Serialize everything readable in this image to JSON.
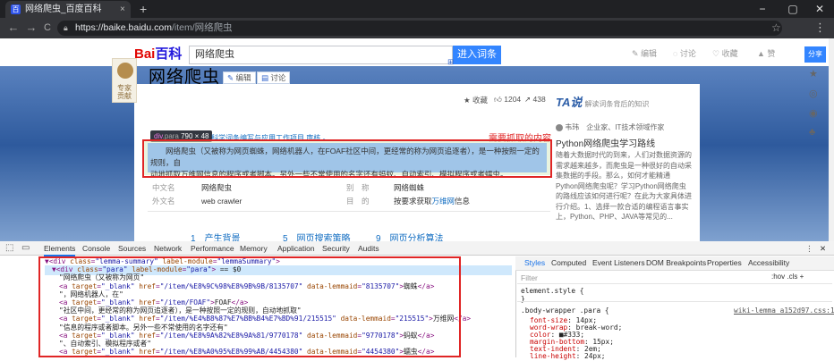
{
  "browser": {
    "tab_title": "网络爬虫_百度百科",
    "tab_close": "×",
    "new_tab": "+",
    "fav_glyph": "百",
    "win_min": "−",
    "win_max": "▢",
    "win_close": "✕",
    "back": "←",
    "forward": "→",
    "reload": "C",
    "url_main": "https://baike.baidu.com",
    "url_path": "/item/网络爬虫",
    "star": "☆",
    "menu": "⋮"
  },
  "page": {
    "logo_a": "Bai",
    "logo_b": "百科",
    "search_value": "网络爬虫",
    "enter_btn": "进入词条",
    "top_links": [
      "✎ 编辑",
      "◌ 讨论",
      "♡ 收藏",
      "▲ 赞"
    ],
    "badge_text": "专家\n贡献",
    "title": "网络爬虫",
    "edit_pill": "编辑",
    "discuss_pill": "讨论",
    "collect": "收藏",
    "like_count": "1204",
    "share_count": "438",
    "tooltip_tag": "div",
    "tooltip_class": ".para",
    "tooltip_dims": "790 × 48",
    "subline": "科学词条编写与应用工作项目 审核 。",
    "red_note": "需要抓取的内容",
    "para_text_1": "网络爬虫（又被称为网页蜘蛛，网络机器人，在FOAF社区中间，更经常的称为网页追逐者），是一种按照一定的规则，自",
    "para_text_2": "动地抓取万维网信息的程序或者脚本。另外一些不常使用的名字还有蚂蚁、自动索引、模拟程序或者蠕虫。",
    "info": {
      "zh_name_k": "中文名",
      "zh_name_v": "网络爬虫",
      "alias_k": "别　称",
      "alias_v": "网络蜘蛛",
      "en_name_k": "外文名",
      "en_name_v": "web crawler",
      "purpose_k": "目　的",
      "purpose_v": "按要求获取",
      "purpose_link": "万维网",
      "purpose_tail": "信息"
    },
    "toc": [
      "1　产生背景",
      "5　网页搜索策略",
      "9　网页分析算法"
    ],
    "right_panel": {
      "ta_logo": "TA说",
      "subtitle": "解读词条背后的知识",
      "author": "韦玮　企业家、IT技术领域作家",
      "article_title": "Python网络爬虫学习路线",
      "article_body": "随着大数据时代的到来，人们对数据资源的需求越来越多，而爬虫是一种很好的自动采集数据的手段。那么，如何才能精通Python网络爬虫呢？学习Python网络爬虫的路线应该如何进行呢？在此为大家具体进行介绍。1、选择一款合适的编程语言事实上，Python、PHP、JAVA等常见的..."
    },
    "share": "分享",
    "share_icons": [
      "★",
      "◎",
      "◉",
      "♣"
    ]
  },
  "devtools": {
    "tabs": [
      "Elements",
      "Console",
      "Sources",
      "Network",
      "Performance",
      "Memory",
      "Application",
      "Security",
      "Audits"
    ],
    "more": "⋮",
    "close": "✕",
    "dom_lines": [
      {
        "indent": 0,
        "parts": [
          [
            "tag",
            "▼<div "
          ],
          [
            "an",
            "class"
          ],
          [
            "tag",
            "="
          ],
          [
            "av",
            "\"lemma-summary\""
          ],
          [
            "an",
            " label-module"
          ],
          [
            "tag",
            "="
          ],
          [
            "av",
            "\"lemmaSummary\""
          ],
          [
            "tag",
            ">"
          ]
        ]
      },
      {
        "indent": 1,
        "parts": [
          [
            "tag",
            "▼<div "
          ],
          [
            "an",
            "class"
          ],
          [
            "tag",
            "="
          ],
          [
            "av",
            "\"para\""
          ],
          [
            "an",
            " label-module"
          ],
          [
            "tag",
            "="
          ],
          [
            "av",
            "\"para\""
          ],
          [
            "tag",
            "> "
          ],
          [
            "txt",
            "== $0"
          ]
        ]
      },
      {
        "indent": 2,
        "parts": [
          [
            "txt",
            "\"网络爬虫（又被称为网页\""
          ]
        ]
      },
      {
        "indent": 2,
        "parts": [
          [
            "tag",
            "<a "
          ],
          [
            "an",
            "target"
          ],
          [
            "tag",
            "="
          ],
          [
            "av",
            "\"_blank\""
          ],
          [
            "an",
            " href"
          ],
          [
            "tag",
            "="
          ],
          [
            "av",
            "\"/item/%E8%9C%98%E8%9B%9B/8135707\""
          ],
          [
            "an",
            " data-lemmaid"
          ],
          [
            "tag",
            "="
          ],
          [
            "av",
            "\"8135707\""
          ],
          [
            "tag",
            ">"
          ],
          [
            "txt",
            "蜘蛛"
          ],
          [
            "tag",
            "</a>"
          ]
        ]
      },
      {
        "indent": 2,
        "parts": [
          [
            "txt",
            "\"，网络机器人，在\""
          ]
        ]
      },
      {
        "indent": 2,
        "parts": [
          [
            "tag",
            "<a "
          ],
          [
            "an",
            "target"
          ],
          [
            "tag",
            "="
          ],
          [
            "av",
            "\"_blank\""
          ],
          [
            "an",
            " href"
          ],
          [
            "tag",
            "="
          ],
          [
            "av",
            "\"/item/FOAF\""
          ],
          [
            "tag",
            ">"
          ],
          [
            "txt",
            "FOAF"
          ],
          [
            "tag",
            "</a>"
          ]
        ]
      },
      {
        "indent": 2,
        "parts": [
          [
            "txt",
            "\"社区中间，更经常的称为网页追逐者），是一种按照一定的规则，自动地抓取\""
          ]
        ]
      },
      {
        "indent": 2,
        "parts": [
          [
            "tag",
            "<a "
          ],
          [
            "an",
            "target"
          ],
          [
            "tag",
            "="
          ],
          [
            "av",
            "\"_blank\""
          ],
          [
            "an",
            " href"
          ],
          [
            "tag",
            "="
          ],
          [
            "av",
            "\"/item/%E4%B8%87%E7%BB%B4%E7%BD%91/215515\""
          ],
          [
            "an",
            " data-lemmaid"
          ],
          [
            "tag",
            "="
          ],
          [
            "av",
            "\"215515\""
          ],
          [
            "tag",
            ">"
          ],
          [
            "txt",
            "万维网"
          ],
          [
            "tag",
            "</a>"
          ]
        ]
      },
      {
        "indent": 2,
        "parts": [
          [
            "txt",
            "\"信息的程序或者脚本。另外一些不常使用的名字还有\""
          ]
        ]
      },
      {
        "indent": 2,
        "parts": [
          [
            "tag",
            "<a "
          ],
          [
            "an",
            "target"
          ],
          [
            "tag",
            "="
          ],
          [
            "av",
            "\"_blank\""
          ],
          [
            "an",
            " href"
          ],
          [
            "tag",
            "="
          ],
          [
            "av",
            "\"/item/%E8%9A%82%E8%9A%81/9770178\""
          ],
          [
            "an",
            " data-lemmaid"
          ],
          [
            "tag",
            "="
          ],
          [
            "av",
            "\"9770178\""
          ],
          [
            "tag",
            ">"
          ],
          [
            "txt",
            "蚂蚁"
          ],
          [
            "tag",
            "</a>"
          ]
        ]
      },
      {
        "indent": 2,
        "parts": [
          [
            "txt",
            "\"、自动索引、模拟程序或者\""
          ]
        ]
      },
      {
        "indent": 2,
        "parts": [
          [
            "tag",
            "<a "
          ],
          [
            "an",
            "target"
          ],
          [
            "tag",
            "="
          ],
          [
            "av",
            "\"_blank\""
          ],
          [
            "an",
            " href"
          ],
          [
            "tag",
            "="
          ],
          [
            "av",
            "\"/item/%E8%A0%95%E8%99%AB/4454380\""
          ],
          [
            "an",
            " data-lemmaid"
          ],
          [
            "tag",
            "="
          ],
          [
            "av",
            "\"4454380\""
          ],
          [
            "tag",
            ">"
          ],
          [
            "txt",
            "蠕虫"
          ],
          [
            "tag",
            "</a>"
          ]
        ]
      }
    ],
    "styles_tabs": [
      "Styles",
      "Computed",
      "Event Listeners",
      "DOM Breakpoints",
      "Properties",
      "Accessibility"
    ],
    "filter_placeholder": "Filter",
    "filter_right": ":hov  .cls  +",
    "element_style": "element.style {",
    "element_style_close": "}",
    "rule_selector": ".body-wrapper .para {",
    "rule_source": "wiki-lemma_a152d97.css:10",
    "rules": [
      {
        "p": "font-size",
        "v": "14px;"
      },
      {
        "p": "word-wrap",
        "v": "break-word;"
      },
      {
        "p": "color",
        "v": "■#333;"
      },
      {
        "p": "margin-bottom",
        "v": "15px;"
      },
      {
        "p": "text-indent",
        "v": "2em;"
      },
      {
        "p": "line-height",
        "v": "24px;"
      }
    ]
  }
}
